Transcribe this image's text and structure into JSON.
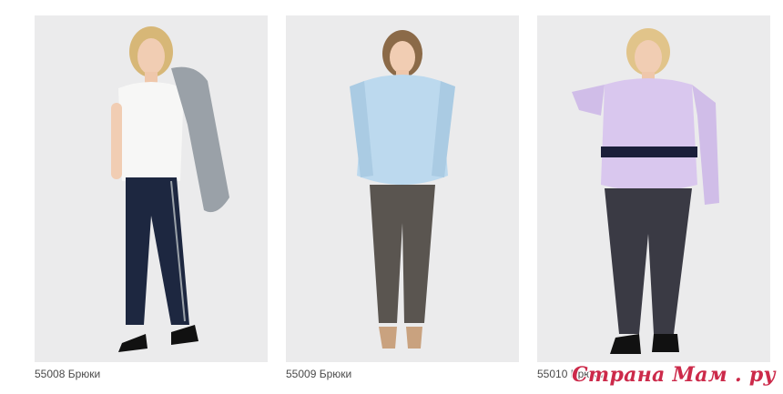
{
  "products": [
    {
      "caption": "55008 Брюки",
      "top_color": "#f7f7f6",
      "pants_color": "#1d2740",
      "accent_color": "#9aa1a8"
    },
    {
      "caption": "55009 Брюки",
      "top_color": "#bcd9ee",
      "pants_color": "#5a5550",
      "accent_color": "#c9a27f"
    },
    {
      "caption": "55010 Брюки",
      "top_color": "#d9c7ee",
      "pants_color": "#3a3a44",
      "accent_color": "#1b1f3a"
    }
  ],
  "watermark": "Страна Мам . ру"
}
